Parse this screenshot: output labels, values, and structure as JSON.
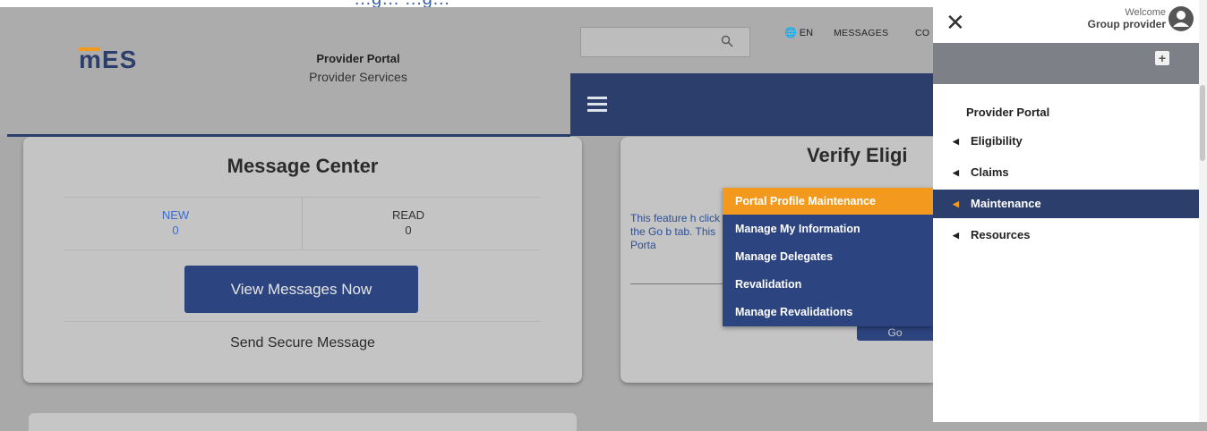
{
  "app": {
    "logo_text": "mES",
    "title": "Provider Portal",
    "subtitle": "Provider Services",
    "top_partial_text": "…g…             …g…"
  },
  "header": {
    "search": {
      "value": "",
      "placeholder": ""
    },
    "language": "EN",
    "nav_links": [
      "MESSAGES",
      "CO"
    ]
  },
  "message_center": {
    "title": "Message Center",
    "new_label": "NEW",
    "new_count": "0",
    "read_label": "READ",
    "read_count": "0",
    "view_button": "View Messages Now",
    "send_link": "Send Secure Message"
  },
  "verify_card": {
    "title": "Verify Eligi",
    "text": "This feature h click the Go b tab. This Porta",
    "go_button": "Go"
  },
  "dropdown": {
    "items": [
      {
        "label": "Portal Profile Maintenance",
        "active": true
      },
      {
        "label": "Manage My Information",
        "active": false
      },
      {
        "label": "Manage Delegates",
        "active": false
      },
      {
        "label": "Revalidation",
        "active": false
      },
      {
        "label": "Manage Revalidations",
        "active": false
      }
    ]
  },
  "side_panel": {
    "welcome": "Welcome",
    "user_name": "Group provider",
    "heading": "Provider Portal",
    "items": [
      {
        "label": "Eligibility",
        "active": false
      },
      {
        "label": "Claims",
        "active": false
      },
      {
        "label": "Maintenance",
        "active": true
      },
      {
        "label": "Resources",
        "active": false
      }
    ]
  },
  "colors": {
    "nav_blue": "#2c3e6c",
    "button_blue": "#2c4480",
    "accent_orange": "#f39a1e",
    "link_blue": "#3b6cd6"
  },
  "icons": [
    "search-icon",
    "globe-icon",
    "hamburger-icon",
    "close-icon",
    "user-avatar-icon",
    "plus-icon",
    "caret-left-icon"
  ]
}
